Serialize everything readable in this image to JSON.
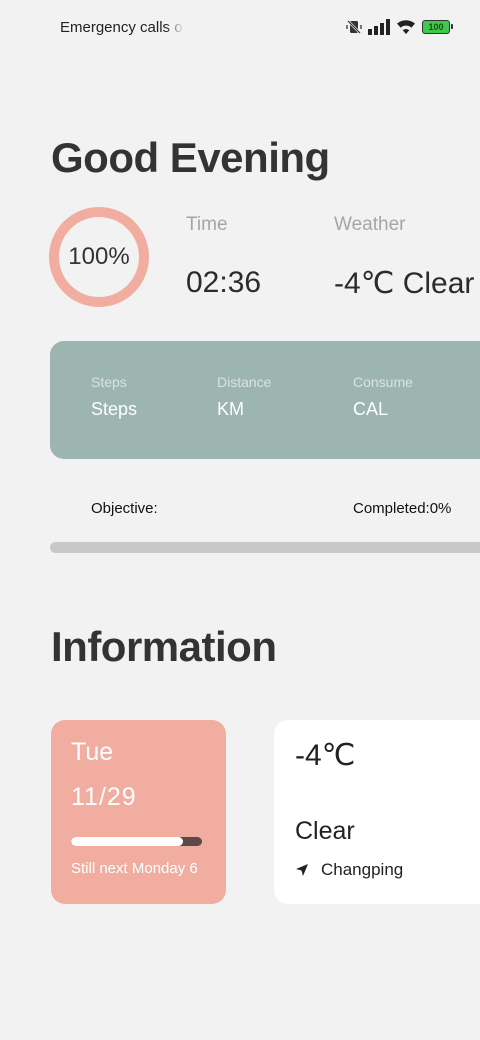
{
  "status_bar": {
    "text": "Emergency calls o",
    "battery": "100",
    "icons": [
      "mute-vibrate-icon",
      "signal-icon",
      "wifi-icon",
      "battery-icon"
    ]
  },
  "greeting": "Good Evening",
  "ring": {
    "label": "100%",
    "value": 1.0,
    "color": "#f0ada0"
  },
  "time": {
    "label": "Time",
    "value": "02:36"
  },
  "weather": {
    "label": "Weather",
    "value": "-4℃ Clear"
  },
  "activity": {
    "steps": {
      "label": "Steps",
      "value": "Steps"
    },
    "distance": {
      "label": "Distance",
      "value": "KM"
    },
    "consume": {
      "label": "Consume",
      "value": "CAL"
    },
    "color": "#9cb5b0"
  },
  "objective": {
    "label": "Objective:",
    "completed": "Completed:0%",
    "progress": 0
  },
  "information": {
    "title": "Information",
    "date_card": {
      "day": "Tue",
      "date": "11/29",
      "note": "Still next Monday 6",
      "week_progress": 0.857,
      "color": "#f0ada0"
    },
    "weather_card": {
      "temp": "-4℃",
      "condition": "Clear",
      "location": "Changping",
      "location_icon": "navigation-arrow-icon"
    }
  }
}
